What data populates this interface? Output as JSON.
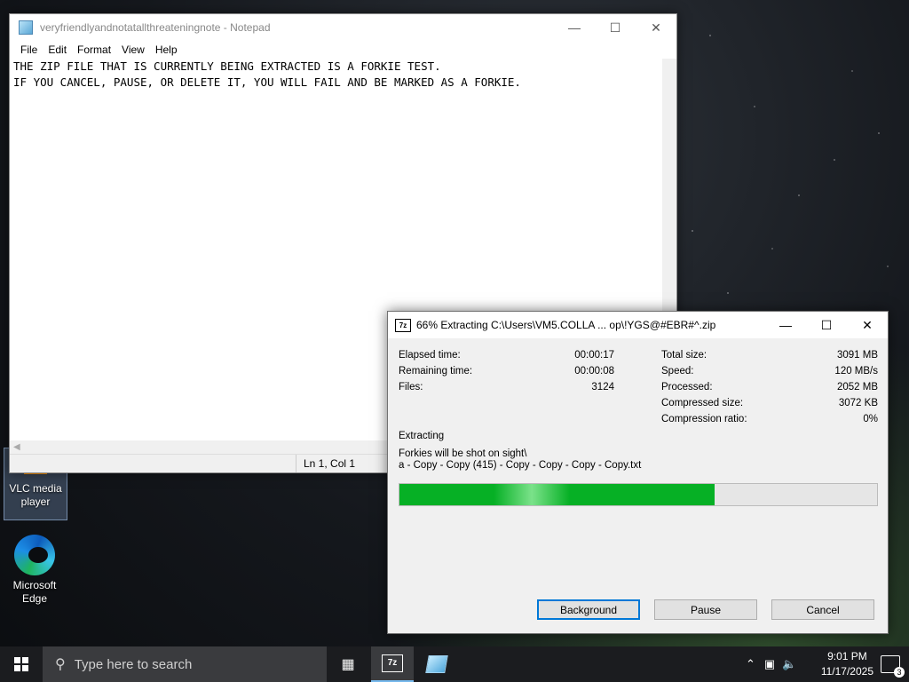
{
  "desktop": {
    "icons": [
      {
        "label": "VLC media player"
      },
      {
        "label": "Microsoft Edge"
      }
    ]
  },
  "notepad": {
    "title": "veryfriendlyandnotatallthreateningnote - Notepad",
    "menu": [
      "File",
      "Edit",
      "Format",
      "View",
      "Help"
    ],
    "lines": [
      "THE ZIP FILE THAT IS CURRENTLY BEING EXTRACTED IS A FORKIE TEST.",
      "IF YOU CANCEL, PAUSE, OR DELETE IT, YOU WILL FAIL AND BE MARKED AS A FORKIE."
    ],
    "status": "Ln 1, Col 1"
  },
  "zip": {
    "title": "66% Extracting C:\\Users\\VM5.COLLA ... op\\!YGS@#EBR#^.zip",
    "left_stats": [
      {
        "label": "Elapsed time:",
        "value": "00:00:17"
      },
      {
        "label": "Remaining time:",
        "value": "00:00:08"
      },
      {
        "label": "Files:",
        "value": "3124"
      }
    ],
    "right_stats": [
      {
        "label": "Total size:",
        "value": "3091 MB"
      },
      {
        "label": "Speed:",
        "value": "120 MB/s"
      },
      {
        "label": "Processed:",
        "value": "2052 MB"
      },
      {
        "label": "Compressed size:",
        "value": "3072 KB"
      },
      {
        "label": "Compression ratio:",
        "value": "0%"
      }
    ],
    "operation": "Extracting",
    "path_line1": "Forkies will be shot on sight\\",
    "path_line2": "a - Copy - Copy (415) - Copy - Copy - Copy - Copy.txt",
    "progress": 0.66,
    "buttons": {
      "background": "Background",
      "pause": "Pause",
      "cancel": "Cancel"
    }
  },
  "taskbar": {
    "search_placeholder": "Type here to search",
    "time": "9:01 PM",
    "date": "11/17/2025",
    "notifications": "3"
  }
}
